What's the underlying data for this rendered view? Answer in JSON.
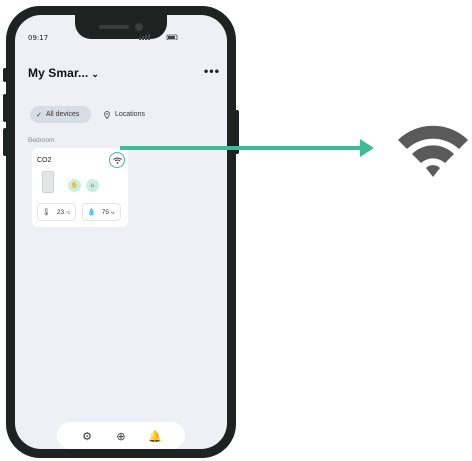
{
  "status_bar": {
    "time": "09:17"
  },
  "header": {
    "title": "My Smar...",
    "title_chevron": "⌄",
    "more_label": "•••"
  },
  "filters": [
    {
      "label": "All devices",
      "icon": "check-icon",
      "selected": true
    },
    {
      "label": "Locations",
      "icon": "location-pin-icon",
      "selected": false
    }
  ],
  "room": {
    "name": "Bedroom"
  },
  "device_card": {
    "name": "CO2",
    "wifi_icon": "wifi-icon",
    "temperature": {
      "value": "23",
      "unit": "°C",
      "icon": "thermometer-icon"
    },
    "humidity": {
      "value": "75",
      "unit": "%",
      "icon": "droplet-icon"
    },
    "mode_icons": [
      "hand-icon",
      "home-icon"
    ]
  },
  "bottom_nav": {
    "icons": [
      "gear-icon",
      "add-circle-icon",
      "bell-icon"
    ]
  },
  "annotation": {
    "icon": "wifi-icon",
    "accent_color": "#3dbb96",
    "wifi_color": "#5a5a5a"
  }
}
